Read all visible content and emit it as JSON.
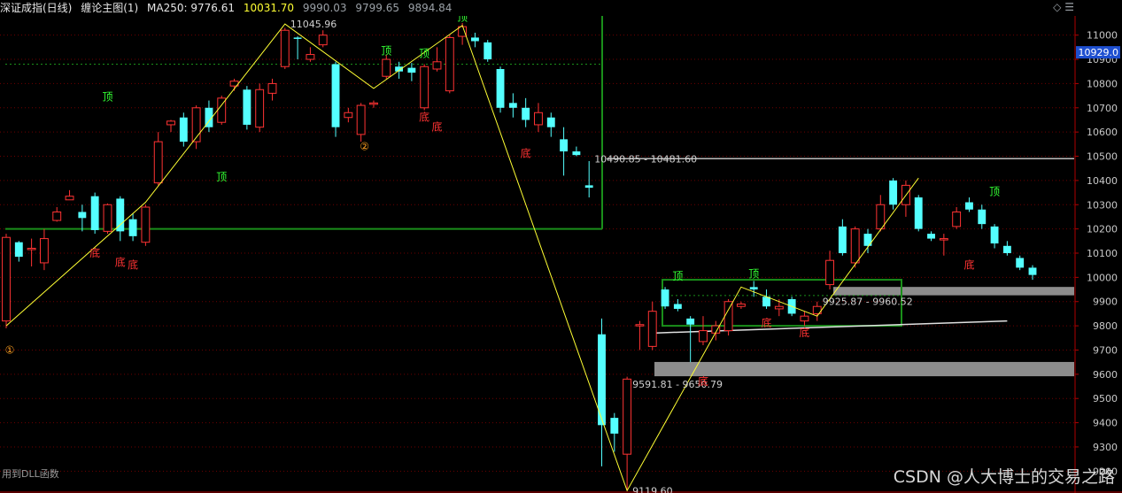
{
  "header": {
    "title": "深证成指(日线)",
    "indicator": "缠论主图(1)",
    "ma_label": "MA250: 9776.61",
    "val1": "10031.70",
    "val2": "9990.03",
    "val3": "9799.65",
    "val4": "9894.84",
    "diamond_icon": "diamond-icon"
  },
  "status": {
    "left_text": "用到DLL函数",
    "watermark": "CSDN @人大博士的交易之路"
  },
  "colors": {
    "up": "#ff3333",
    "down": "#54ffff",
    "axis": "#b00000",
    "grid": "#6e0000",
    "zigzag": "#ffff33",
    "box": "#1a8f1a",
    "zone": "#8c8c8c",
    "top_label": "#33ff33",
    "bottom_label": "#ff3333"
  },
  "chart_data": {
    "type": "candlestick",
    "ylim": [
      9150,
      11050
    ],
    "y_ticks": [
      "11000",
      "10900",
      "10800",
      "10700",
      "10600",
      "10500",
      "10400",
      "10300",
      "10200",
      "10100",
      "10000",
      "9900",
      "9800",
      "9700",
      "9600",
      "9500",
      "9400",
      "9300",
      "9200"
    ],
    "current_price": "10929.0",
    "candles": [
      {
        "o": 9820,
        "c": 10165,
        "h": 10180,
        "l": 9790
      },
      {
        "o": 10145,
        "c": 10085,
        "h": 10150,
        "l": 10065
      },
      {
        "o": 10115,
        "c": 10120,
        "h": 10160,
        "l": 10045
      },
      {
        "o": 10060,
        "c": 10160,
        "h": 10200,
        "l": 10030
      },
      {
        "o": 10235,
        "c": 10270,
        "h": 10290,
        "l": 10230
      },
      {
        "o": 10320,
        "c": 10335,
        "h": 10360,
        "l": 10320
      },
      {
        "o": 10270,
        "c": 10245,
        "h": 10300,
        "l": 10190
      },
      {
        "o": 10335,
        "c": 10195,
        "h": 10350,
        "l": 10180
      },
      {
        "o": 10190,
        "c": 10300,
        "h": 10305,
        "l": 10180
      },
      {
        "o": 10325,
        "c": 10190,
        "h": 10335,
        "l": 10150
      },
      {
        "o": 10240,
        "c": 10170,
        "h": 10265,
        "l": 10150
      },
      {
        "o": 10145,
        "c": 10290,
        "h": 10300,
        "l": 10130
      },
      {
        "o": 10390,
        "c": 10560,
        "h": 10600,
        "l": 10380
      },
      {
        "o": 10630,
        "c": 10645,
        "h": 10650,
        "l": 10600
      },
      {
        "o": 10660,
        "c": 10560,
        "h": 10680,
        "l": 10540
      },
      {
        "o": 10560,
        "c": 10700,
        "h": 10710,
        "l": 10530
      },
      {
        "o": 10700,
        "c": 10620,
        "h": 10730,
        "l": 10600
      },
      {
        "o": 10640,
        "c": 10740,
        "h": 10750,
        "l": 10630
      },
      {
        "o": 10790,
        "c": 10810,
        "h": 10820,
        "l": 10770
      },
      {
        "o": 10775,
        "c": 10630,
        "h": 10790,
        "l": 10610
      },
      {
        "o": 10620,
        "c": 10775,
        "h": 10800,
        "l": 10600
      },
      {
        "o": 10760,
        "c": 10800,
        "h": 10820,
        "l": 10730
      },
      {
        "o": 10870,
        "c": 11020,
        "h": 11030,
        "l": 10860
      },
      {
        "o": 10990,
        "c": 10985,
        "h": 10995,
        "l": 10900
      },
      {
        "o": 10900,
        "c": 10920,
        "h": 10950,
        "l": 10890
      },
      {
        "o": 10960,
        "c": 11000,
        "h": 11020,
        "l": 10950
      },
      {
        "o": 10880,
        "c": 10620,
        "h": 10890,
        "l": 10580
      },
      {
        "o": 10660,
        "c": 10680,
        "h": 10700,
        "l": 10640
      },
      {
        "o": 10590,
        "c": 10710,
        "h": 10720,
        "l": 10560
      },
      {
        "o": 10715,
        "c": 10720,
        "h": 10730,
        "l": 10700
      },
      {
        "o": 10830,
        "c": 10900,
        "h": 10920,
        "l": 10820
      },
      {
        "o": 10870,
        "c": 10850,
        "h": 10890,
        "l": 10820
      },
      {
        "o": 10865,
        "c": 10845,
        "h": 10885,
        "l": 10810
      },
      {
        "o": 10700,
        "c": 10870,
        "h": 10880,
        "l": 10690
      },
      {
        "o": 10860,
        "c": 10890,
        "h": 10950,
        "l": 10850
      },
      {
        "o": 10770,
        "c": 10990,
        "h": 11000,
        "l": 10760
      },
      {
        "o": 10995,
        "c": 11035,
        "h": 11050,
        "l": 10960
      },
      {
        "o": 10990,
        "c": 10975,
        "h": 11010,
        "l": 10950
      },
      {
        "o": 10970,
        "c": 10900,
        "h": 10980,
        "l": 10890
      },
      {
        "o": 10860,
        "c": 10700,
        "h": 10870,
        "l": 10680
      },
      {
        "o": 10720,
        "c": 10700,
        "h": 10760,
        "l": 10660
      },
      {
        "o": 10700,
        "c": 10650,
        "h": 10740,
        "l": 10620
      },
      {
        "o": 10630,
        "c": 10680,
        "h": 10720,
        "l": 10600
      },
      {
        "o": 10660,
        "c": 10620,
        "h": 10680,
        "l": 10580
      },
      {
        "o": 10570,
        "c": 10520,
        "h": 10620,
        "l": 10420
      },
      {
        "o": 10520,
        "c": 10505,
        "h": 10540,
        "l": 10500
      },
      {
        "o": 10380,
        "c": 10370,
        "h": 10480,
        "l": 10330
      },
      {
        "o": 9765,
        "c": 9390,
        "h": 9830,
        "l": 9220
      },
      {
        "o": 9420,
        "c": 9355,
        "h": 9440,
        "l": 9280
      },
      {
        "o": 9270,
        "c": 9580,
        "h": 9590,
        "l": 9120
      },
      {
        "o": 9800,
        "c": 9805,
        "h": 9820,
        "l": 9700
      },
      {
        "o": 9715,
        "c": 9860,
        "h": 9900,
        "l": 9700
      },
      {
        "o": 9950,
        "c": 9880,
        "h": 9960,
        "l": 9870
      },
      {
        "o": 9890,
        "c": 9870,
        "h": 9910,
        "l": 9860
      },
      {
        "o": 9830,
        "c": 9805,
        "h": 9840,
        "l": 9650
      },
      {
        "o": 9735,
        "c": 9780,
        "h": 9840,
        "l": 9720
      },
      {
        "o": 9770,
        "c": 9800,
        "h": 9820,
        "l": 9740
      },
      {
        "o": 9780,
        "c": 9900,
        "h": 9910,
        "l": 9760
      },
      {
        "o": 9880,
        "c": 9890,
        "h": 9900,
        "l": 9870
      },
      {
        "o": 9960,
        "c": 9950,
        "h": 9985,
        "l": 9920
      },
      {
        "o": 9920,
        "c": 9880,
        "h": 9950,
        "l": 9870
      },
      {
        "o": 9870,
        "c": 9880,
        "h": 9910,
        "l": 9840
      },
      {
        "o": 9910,
        "c": 9850,
        "h": 9920,
        "l": 9840
      },
      {
        "o": 9820,
        "c": 9840,
        "h": 9860,
        "l": 9800
      },
      {
        "o": 9850,
        "c": 9880,
        "h": 9900,
        "l": 9820
      },
      {
        "o": 9970,
        "c": 10070,
        "h": 10110,
        "l": 9950
      },
      {
        "o": 10210,
        "c": 10100,
        "h": 10240,
        "l": 10090
      },
      {
        "o": 10060,
        "c": 10200,
        "h": 10210,
        "l": 10040
      },
      {
        "o": 10180,
        "c": 10130,
        "h": 10200,
        "l": 10100
      },
      {
        "o": 10200,
        "c": 10300,
        "h": 10340,
        "l": 10190
      },
      {
        "o": 10400,
        "c": 10300,
        "h": 10410,
        "l": 10280
      },
      {
        "o": 10300,
        "c": 10380,
        "h": 10400,
        "l": 10250
      },
      {
        "o": 10330,
        "c": 10200,
        "h": 10340,
        "l": 10190
      },
      {
        "o": 10180,
        "c": 10160,
        "h": 10190,
        "l": 10150
      },
      {
        "o": 10160,
        "c": 10160,
        "h": 10180,
        "l": 10090
      },
      {
        "o": 10210,
        "c": 10270,
        "h": 10290,
        "l": 10200
      },
      {
        "o": 10310,
        "c": 10280,
        "h": 10330,
        "l": 10270
      },
      {
        "o": 10280,
        "c": 10220,
        "h": 10300,
        "l": 10200
      },
      {
        "o": 10210,
        "c": 10140,
        "h": 10220,
        "l": 10120
      },
      {
        "o": 10130,
        "c": 10100,
        "h": 10150,
        "l": 10090
      },
      {
        "o": 10080,
        "c": 10040,
        "h": 10090,
        "l": 10030
      },
      {
        "o": 10040,
        "c": 10010,
        "h": 10050,
        "l": 9990
      }
    ],
    "zigzag": [
      [
        0,
        9800
      ],
      [
        11,
        10310
      ],
      [
        22,
        11045.96
      ],
      [
        29,
        10780
      ],
      [
        36,
        11040
      ],
      [
        49,
        9119.6
      ],
      [
        58,
        9960
      ],
      [
        64,
        9840
      ],
      [
        72,
        10410
      ]
    ],
    "box_1": {
      "x0": 0,
      "x1": 46,
      "ylow": 10200,
      "yhigh": 11050
    },
    "box_1_line": 10880,
    "box_2": {
      "x0": 50,
      "x1": 68,
      "ylow": 9800,
      "yhigh": 9990
    },
    "box_2_line": 9925,
    "zone_upper": [
      9925.87,
      9960.52
    ],
    "zone_lower": [
      9591.81,
      9650.79
    ],
    "line_10490": 10490,
    "trend_line": [
      [
        51,
        9770
      ],
      [
        79,
        9820
      ]
    ],
    "annotations": [
      {
        "text": "11045.96",
        "x": 22,
        "y": 11045.96
      },
      {
        "text": "10490.85 - 10481.60",
        "x": 46,
        "y": 10490
      },
      {
        "text": "9925.87 - 9960.52",
        "x": 64,
        "y": 9900
      },
      {
        "text": "9591.81 - 9650.79",
        "x": 49,
        "y": 9560
      },
      {
        "text": "9119.60",
        "x": 49,
        "y": 9119.6
      }
    ],
    "top_marks": [
      [
        17,
        10400,
        "顶"
      ],
      [
        8,
        10730,
        "顶"
      ],
      [
        30,
        10920,
        "顶"
      ],
      [
        33,
        10910,
        "顶"
      ],
      [
        36,
        11060,
        "顶"
      ],
      [
        53,
        9990,
        "顶"
      ],
      [
        59,
        10000,
        "顶"
      ],
      [
        78,
        10340,
        "顶"
      ]
    ],
    "bottom_marks": [
      [
        7,
        10130,
        "底"
      ],
      [
        9,
        10090,
        "底"
      ],
      [
        10,
        10080,
        "底"
      ],
      [
        33,
        10690,
        "底"
      ],
      [
        34,
        10650,
        "底"
      ],
      [
        41,
        10540,
        "底"
      ],
      [
        55,
        9600,
        "底"
      ],
      [
        60,
        9840,
        "底"
      ],
      [
        63,
        9800,
        "底"
      ],
      [
        76,
        10080,
        "底"
      ]
    ],
    "circle_marks": [
      [
        0,
        9700,
        "①"
      ],
      [
        28,
        10540,
        "②"
      ]
    ]
  }
}
